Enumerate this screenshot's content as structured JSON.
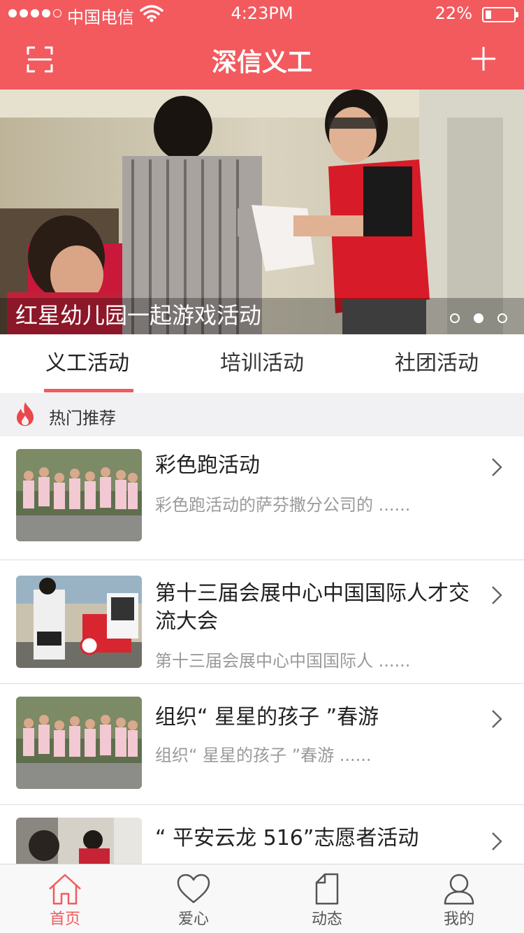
{
  "status_bar": {
    "carrier": "中国电信",
    "time": "4:23PM",
    "battery_percent": "22%",
    "battery_level": 0.22
  },
  "nav": {
    "title": "深信义工",
    "left_icon": "scan-icon",
    "right_icon": "plus-icon"
  },
  "banner": {
    "caption": "红星幼儿园一起游戏活动",
    "page_count": 3,
    "active_page": 2
  },
  "tabs": [
    {
      "label": "义工活动",
      "active": true
    },
    {
      "label": "培训活动",
      "active": false
    },
    {
      "label": "社团活动",
      "active": false
    }
  ],
  "section": {
    "icon": "fire-icon",
    "title": "热门推荐"
  },
  "activities": [
    {
      "title": "彩色跑活动",
      "desc": "彩色跑活动的萨芬撒分公司的 ......"
    },
    {
      "title": "第十三届会展中心中国国际人才交流大会",
      "desc": "第十三届会展中心中国国际人 ......"
    },
    {
      "title": "组织“ 星星的孩子 ”春游",
      "desc": "组织“ 星星的孩子 ”春游 ......"
    },
    {
      "title": "“ 平安云龙 516”志愿者活动",
      "desc": ""
    }
  ],
  "tab_bar": [
    {
      "label": "首页",
      "icon": "home-icon",
      "active": true
    },
    {
      "label": "爱心",
      "icon": "heart-icon",
      "active": false
    },
    {
      "label": "动态",
      "icon": "document-icon",
      "active": false
    },
    {
      "label": "我的",
      "icon": "user-icon",
      "active": false
    }
  ],
  "colors": {
    "brand": "#f25a5e",
    "muted_text": "#9a9a9a",
    "section_bg": "#f1f1f3"
  }
}
